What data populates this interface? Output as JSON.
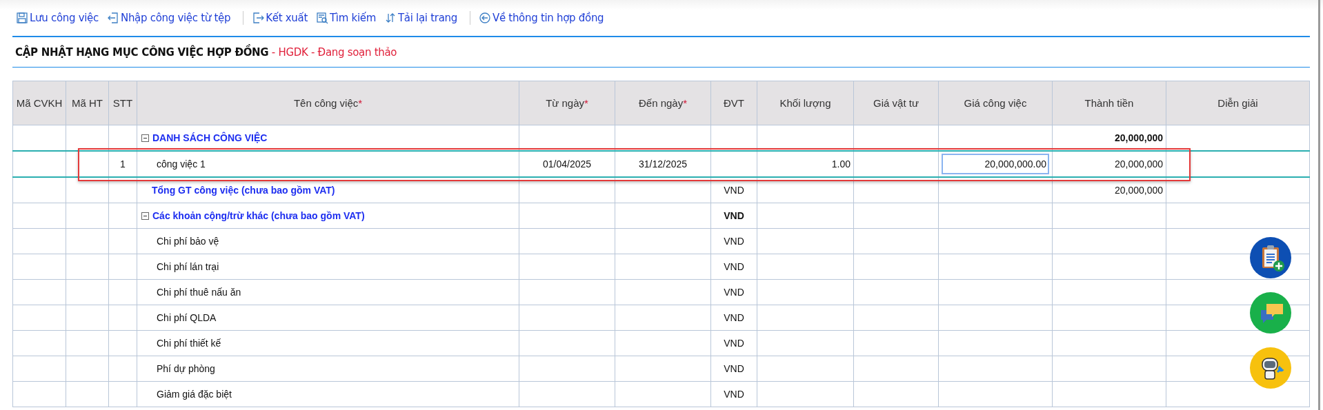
{
  "toolbar": [
    {
      "label": "Lưu công việc",
      "separator_after": false
    },
    {
      "label": "Nhập công việc từ tệp",
      "separator_after": true
    },
    {
      "label": "Kết xuất",
      "separator_after": false
    },
    {
      "label": "Tìm kiếm",
      "separator_after": false
    },
    {
      "label": "Tải lại trang",
      "separator_after": true
    },
    {
      "label": "Về thông tin hợp đồng",
      "separator_after": false
    }
  ],
  "heading": {
    "title": "CẬP NHẬT HẠNG MỤC CÔNG VIỆC HỢP ĐỒNG",
    "code": " - HGDK - ",
    "status": "Đang soạn thảo"
  },
  "table": {
    "columns": [
      {
        "label": "Mã CVKH"
      },
      {
        "label": "Mã HT"
      },
      {
        "label": "STT"
      },
      {
        "label": "Tên công việc",
        "required_mark": "*"
      },
      {
        "label": "Từ ngày",
        "required_mark": "*"
      },
      {
        "label": "Đến ngày",
        "required_mark": "*"
      },
      {
        "label": "ĐVT"
      },
      {
        "label": "Khối lượng"
      },
      {
        "label": "Giá vật tư"
      },
      {
        "label": "Giá công việc"
      },
      {
        "label": "Thành tiền"
      },
      {
        "label": "Diễn giải"
      }
    ],
    "rows": [
      {
        "kind": "group",
        "expanded": true,
        "selected": false,
        "highlighted": false,
        "cells": {
          "name": "DANH SÁCH CÔNG VIỆC",
          "total": "20,000,000"
        }
      },
      {
        "kind": "item",
        "selected": true,
        "highlighted": true,
        "cells": {
          "stt": "1",
          "name": "công việc 1",
          "from": "01/04/2025",
          "to": "31/12/2025",
          "qty": "1.00",
          "price": "20,000,000.00",
          "total": "20,000,000"
        }
      },
      {
        "kind": "total",
        "selected": false,
        "highlighted": false,
        "cells": {
          "name": "Tổng GT công việc (chưa bao gồm VAT)",
          "unit": "VND",
          "total": "20,000,000"
        }
      },
      {
        "kind": "group",
        "expanded": true,
        "selected": false,
        "highlighted": false,
        "cells": {
          "name": "Các khoản cộng/trừ khác (chưa bao gồm VAT)",
          "unit": "VND"
        }
      },
      {
        "kind": "subitem",
        "selected": false,
        "highlighted": false,
        "cells": {
          "name": "Chi phí bảo vệ",
          "unit": "VND"
        }
      },
      {
        "kind": "subitem",
        "selected": false,
        "highlighted": false,
        "cells": {
          "name": "Chi phí lán trại",
          "unit": "VND"
        }
      },
      {
        "kind": "subitem",
        "selected": false,
        "highlighted": false,
        "cells": {
          "name": "Chi phí thuê nấu ăn",
          "unit": "VND"
        }
      },
      {
        "kind": "subitem",
        "selected": false,
        "highlighted": false,
        "cells": {
          "name": "Chi phí QLDA",
          "unit": "VND"
        }
      },
      {
        "kind": "subitem",
        "selected": false,
        "highlighted": false,
        "cells": {
          "name": "Chi phí thiết kế",
          "unit": "VND"
        }
      },
      {
        "kind": "subitem",
        "selected": false,
        "highlighted": false,
        "cells": {
          "name": "Phí dự phòng",
          "unit": "VND"
        }
      },
      {
        "kind": "subitem",
        "selected": false,
        "highlighted": false,
        "cells": {
          "name": "Giảm giá đặc biệt",
          "unit": "VND"
        }
      }
    ]
  }
}
